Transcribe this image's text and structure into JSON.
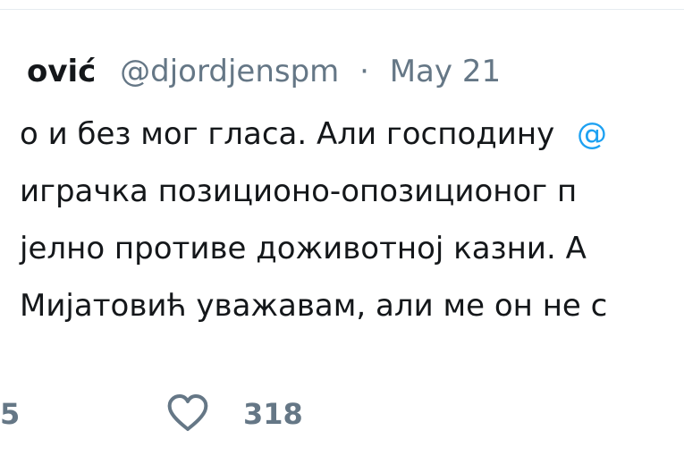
{
  "tweet": {
    "display_name": "ović",
    "handle": "@djordjenspm",
    "separator": "·",
    "date": "May 21",
    "lines": [
      "о и без мог гласа. Али господину",
      "играчка позиционо-опозиционог п",
      "јелно противе доживотној казни. А",
      "Мијатовић уважавам, али ме он не с"
    ],
    "mention": "@"
  },
  "actions": {
    "reply_or_retweet_count": "5",
    "like_count": "318",
    "icons": {
      "like": "heart-outline-icon"
    },
    "colors": {
      "text": "#14171a",
      "muted": "#657786",
      "link": "#1da1f2"
    }
  }
}
